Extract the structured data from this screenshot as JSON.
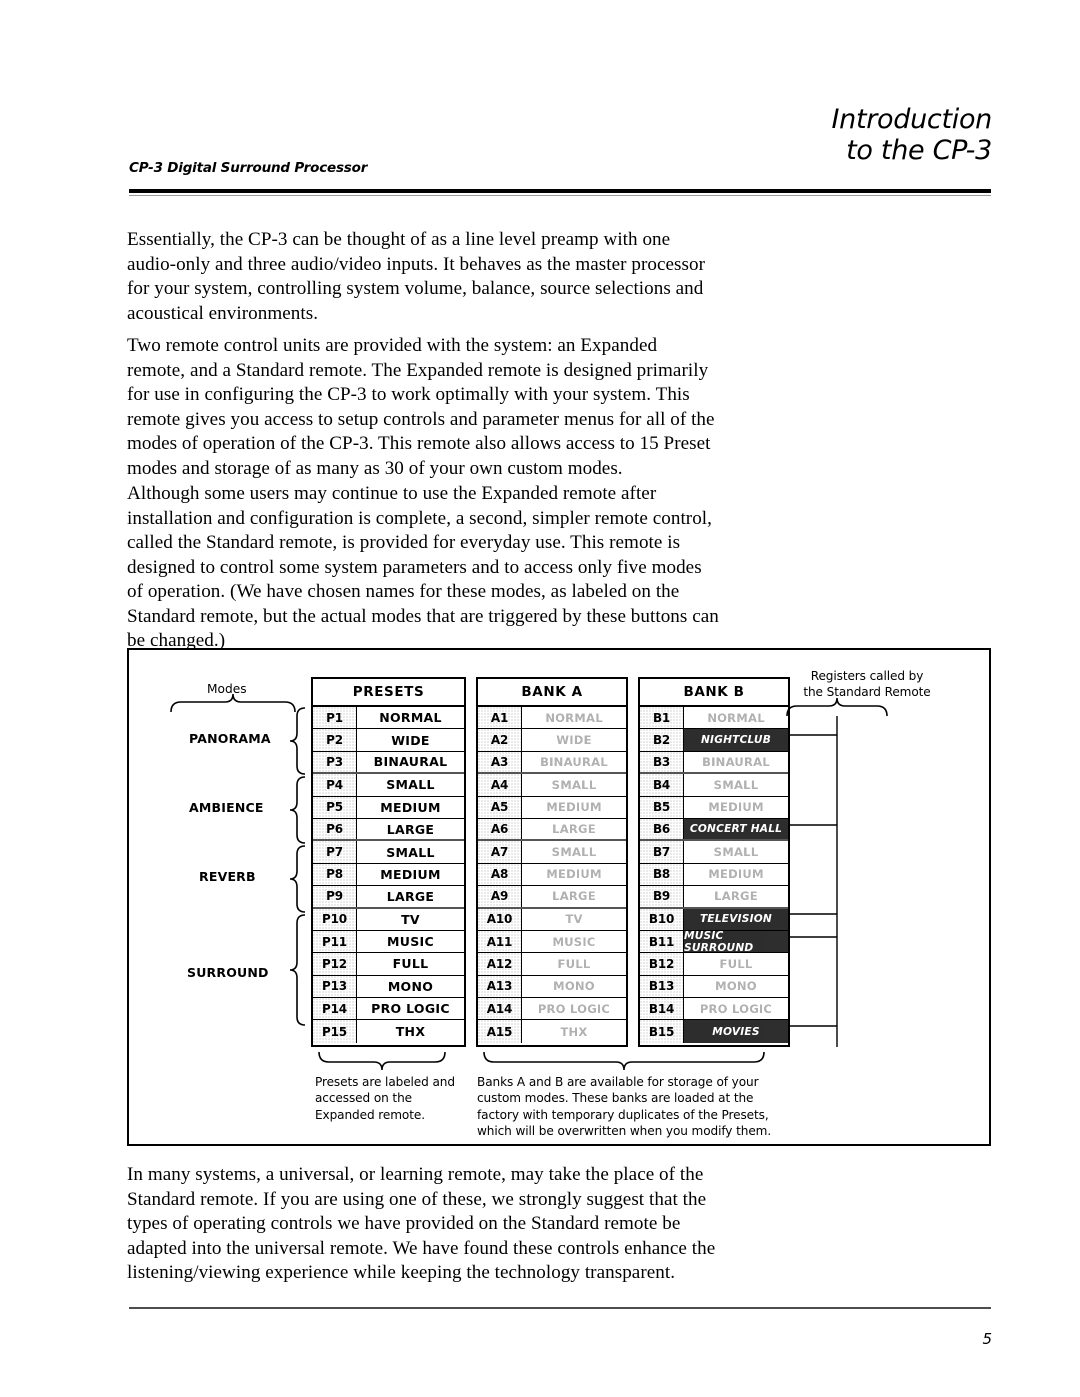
{
  "header": {
    "title_line1": "Introduction",
    "title_line2": "to the CP-3",
    "subtitle": "CP-3 Digital Surround Processor"
  },
  "paragraphs": {
    "p1": "Essentially, the CP-3 can be thought of as a line level preamp with one audio-only and three audio/video inputs. It behaves as the master processor for your system, controlling system volume, balance, source selections and acoustical environments.",
    "p2": "Two remote control units are provided with the system: an Expanded remote, and a Standard remote. The Expanded remote is designed primarily for use in configuring the CP-3 to work optimally with your system. This remote gives you access to setup controls and parameter menus for all of the modes of operation of the CP-3. This remote also allows access to 15 Preset modes and storage of as many as 30 of your own custom modes.",
    "p3": "Although some users may continue to use the Expanded remote after installation and configuration is complete, a second, simpler remote control, called the Standard remote, is provided for everyday use. This remote is designed to control some system parameters and to access only five modes of operation. (We have chosen names for these modes, as labeled on the Standard remote, but the actual modes that are triggered by these buttons can be changed.)",
    "p4": "In many systems, a universal, or learning remote, may take the place of the Standard remote. If you are using one of these, we strongly suggest that the types of operating controls we have provided on the Standard remote be adapted into the universal remote. We have found these controls enhance the listening/viewing experience while keeping the technology transparent."
  },
  "figure": {
    "modes_label": "Modes",
    "mode_groups": [
      {
        "label": "PANORAMA",
        "rows": 3
      },
      {
        "label": "AMBIENCE",
        "rows": 3
      },
      {
        "label": "REVERB",
        "rows": 3
      },
      {
        "label": "SURROUND",
        "rows": 6
      }
    ],
    "columns": [
      {
        "key": "presets",
        "header": "PRESETS"
      },
      {
        "key": "bank_a",
        "header": "BANK A"
      },
      {
        "key": "bank_b",
        "header": "BANK B"
      }
    ],
    "registers_note_line1": "Registers called by",
    "registers_note_line2": "the Standard Remote",
    "presets": [
      {
        "id": "P1",
        "name": "NORMAL"
      },
      {
        "id": "P2",
        "name": "WIDE"
      },
      {
        "id": "P3",
        "name": "BINAURAL"
      },
      {
        "id": "P4",
        "name": "SMALL"
      },
      {
        "id": "P5",
        "name": "MEDIUM"
      },
      {
        "id": "P6",
        "name": "LARGE"
      },
      {
        "id": "P7",
        "name": "SMALL"
      },
      {
        "id": "P8",
        "name": "MEDIUM"
      },
      {
        "id": "P9",
        "name": "LARGE"
      },
      {
        "id": "P10",
        "name": "TV"
      },
      {
        "id": "P11",
        "name": "MUSIC"
      },
      {
        "id": "P12",
        "name": "FULL"
      },
      {
        "id": "P13",
        "name": "MONO"
      },
      {
        "id": "P14",
        "name": "PRO LOGIC"
      },
      {
        "id": "P15",
        "name": "THX"
      }
    ],
    "bank_a": [
      {
        "id": "A1",
        "name": "NORMAL",
        "highlight": false
      },
      {
        "id": "A2",
        "name": "WIDE",
        "highlight": false
      },
      {
        "id": "A3",
        "name": "BINAURAL",
        "highlight": false
      },
      {
        "id": "A4",
        "name": "SMALL",
        "highlight": false
      },
      {
        "id": "A5",
        "name": "MEDIUM",
        "highlight": false
      },
      {
        "id": "A6",
        "name": "LARGE",
        "highlight": false
      },
      {
        "id": "A7",
        "name": "SMALL",
        "highlight": false
      },
      {
        "id": "A8",
        "name": "MEDIUM",
        "highlight": false
      },
      {
        "id": "A9",
        "name": "LARGE",
        "highlight": false
      },
      {
        "id": "A10",
        "name": "TV",
        "highlight": false
      },
      {
        "id": "A11",
        "name": "MUSIC",
        "highlight": false
      },
      {
        "id": "A12",
        "name": "FULL",
        "highlight": false
      },
      {
        "id": "A13",
        "name": "MONO",
        "highlight": false
      },
      {
        "id": "A14",
        "name": "PRO LOGIC",
        "highlight": false
      },
      {
        "id": "A15",
        "name": "THX",
        "highlight": false
      }
    ],
    "bank_b": [
      {
        "id": "B1",
        "name": "NORMAL",
        "highlight": false
      },
      {
        "id": "B2",
        "name": "NIGHTCLUB",
        "highlight": true
      },
      {
        "id": "B3",
        "name": "BINAURAL",
        "highlight": false
      },
      {
        "id": "B4",
        "name": "SMALL",
        "highlight": false
      },
      {
        "id": "B5",
        "name": "MEDIUM",
        "highlight": false
      },
      {
        "id": "B6",
        "name": "CONCERT HALL",
        "highlight": true
      },
      {
        "id": "B7",
        "name": "SMALL",
        "highlight": false
      },
      {
        "id": "B8",
        "name": "MEDIUM",
        "highlight": false
      },
      {
        "id": "B9",
        "name": "LARGE",
        "highlight": false
      },
      {
        "id": "B10",
        "name": "TELEVISION",
        "highlight": true
      },
      {
        "id": "B11",
        "name": "MUSIC SURROUND",
        "highlight": true
      },
      {
        "id": "B12",
        "name": "FULL",
        "highlight": false
      },
      {
        "id": "B13",
        "name": "MONO",
        "highlight": false
      },
      {
        "id": "B14",
        "name": "PRO LOGIC",
        "highlight": false
      },
      {
        "id": "B15",
        "name": "MOVIES",
        "highlight": true
      }
    ],
    "caption_presets": "Presets are labeled and accessed on the Expanded remote.",
    "caption_banks": "Banks A and B are available for storage of your custom modes. These banks are loaded at the factory with temporary duplicates of the Presets, which will be overwritten when you modify them."
  },
  "footer": {
    "page_number": "5"
  }
}
